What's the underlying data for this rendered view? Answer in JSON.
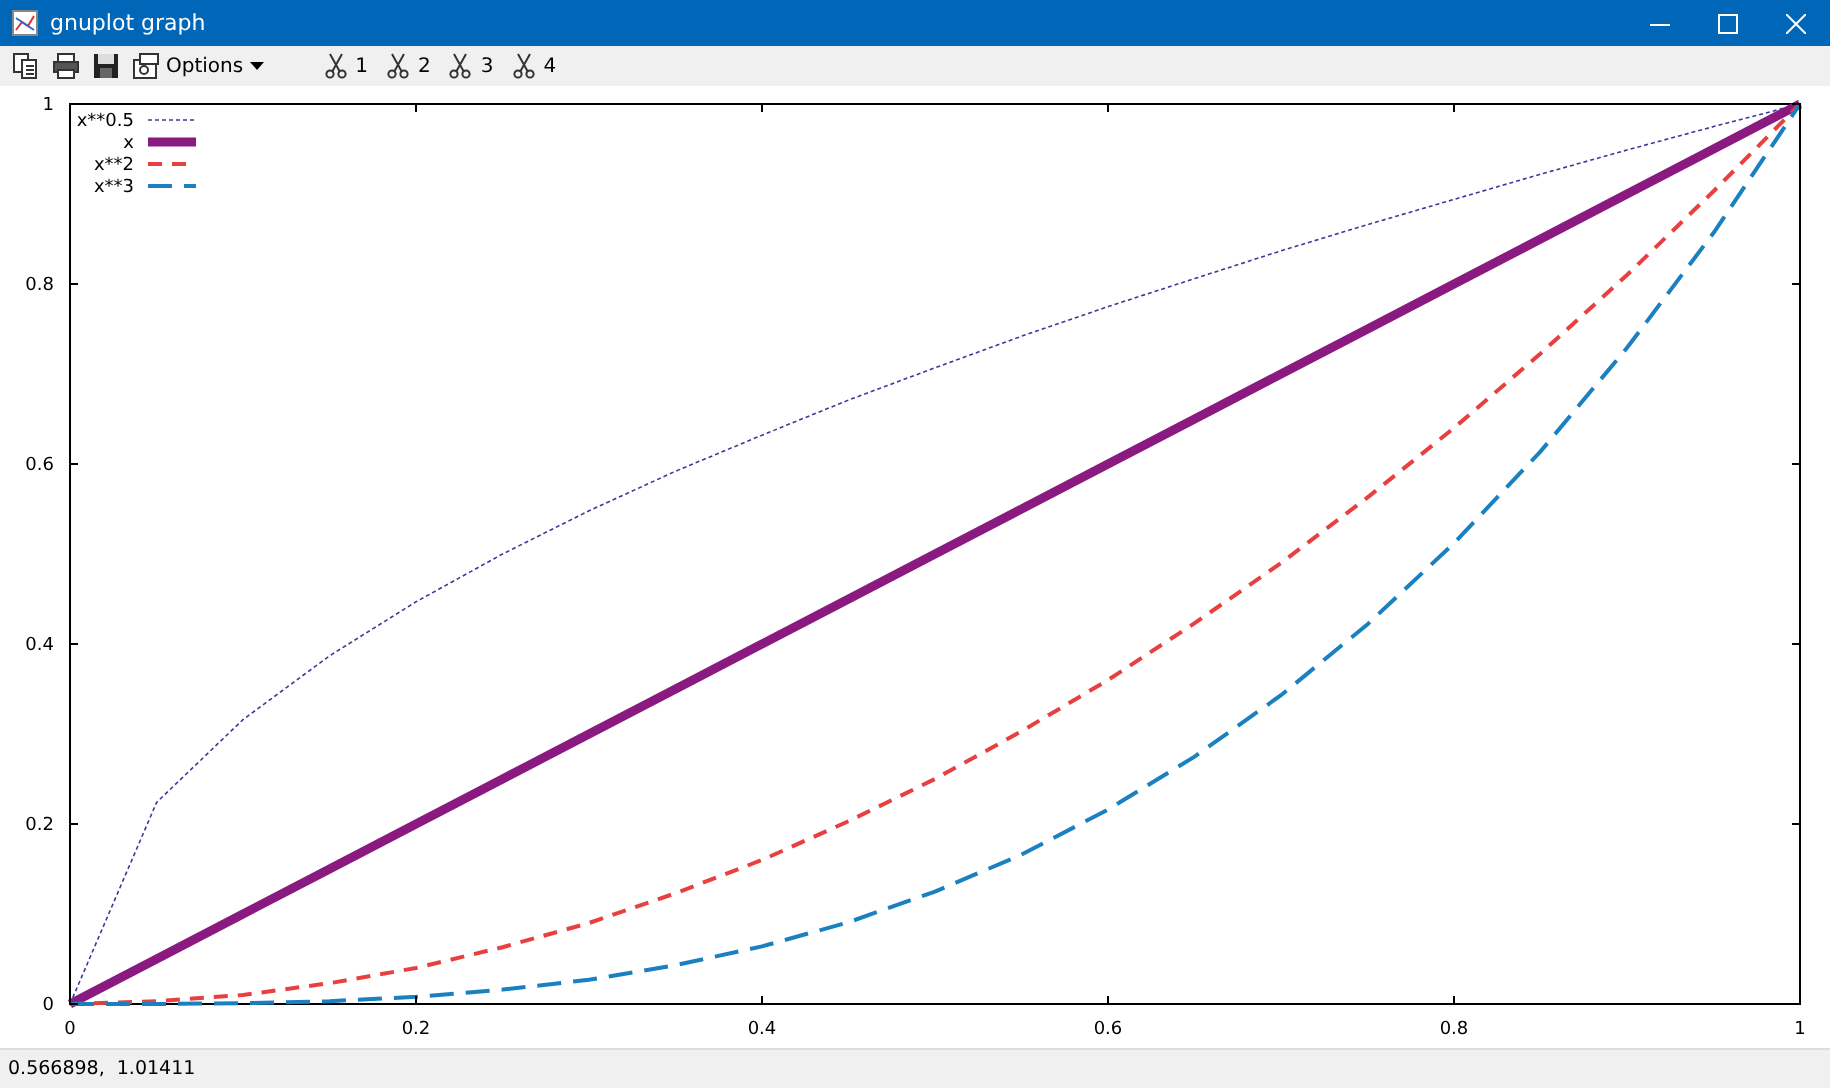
{
  "window": {
    "title": "gnuplot graph"
  },
  "toolbar": {
    "buttons": [
      {
        "kind": "copy"
      },
      {
        "kind": "print"
      },
      {
        "kind": "save"
      },
      {
        "kind": "options",
        "label": "Options"
      },
      {
        "kind": "scissors",
        "label": "1"
      },
      {
        "kind": "scissors",
        "label": "2"
      },
      {
        "kind": "scissors",
        "label": "3"
      },
      {
        "kind": "scissors",
        "label": "4"
      }
    ]
  },
  "plot": {
    "chart_data": {
      "type": "line",
      "x": [
        0,
        0.05,
        0.1,
        0.15,
        0.2,
        0.25,
        0.3,
        0.35,
        0.4,
        0.45,
        0.5,
        0.55,
        0.6,
        0.65,
        0.7,
        0.75,
        0.8,
        0.85,
        0.9,
        0.95,
        1
      ],
      "series": [
        {
          "name": "x**0.5",
          "color": "#3a3a9a",
          "line_style": "dotted",
          "values": [
            0,
            0.224,
            0.316,
            0.387,
            0.447,
            0.5,
            0.548,
            0.592,
            0.632,
            0.671,
            0.707,
            0.742,
            0.775,
            0.806,
            0.837,
            0.866,
            0.894,
            0.922,
            0.949,
            0.975,
            1
          ]
        },
        {
          "name": "x",
          "color": "#8b1a80",
          "line_style": "solid",
          "values": [
            0,
            0.05,
            0.1,
            0.15,
            0.2,
            0.25,
            0.3,
            0.35,
            0.4,
            0.45,
            0.5,
            0.55,
            0.6,
            0.65,
            0.7,
            0.75,
            0.8,
            0.85,
            0.9,
            0.95,
            1
          ]
        },
        {
          "name": "x**2",
          "color": "#e84040",
          "line_style": "dashed",
          "values": [
            0,
            0.003,
            0.01,
            0.023,
            0.04,
            0.063,
            0.09,
            0.123,
            0.16,
            0.203,
            0.25,
            0.303,
            0.36,
            0.423,
            0.49,
            0.563,
            0.64,
            0.723,
            0.81,
            0.903,
            1
          ]
        },
        {
          "name": "x**3",
          "color": "#1a80c0",
          "line_style": "long-dashed",
          "values": [
            0,
            0,
            0.001,
            0.003,
            0.008,
            0.016,
            0.027,
            0.043,
            0.064,
            0.091,
            0.125,
            0.166,
            0.216,
            0.275,
            0.343,
            0.422,
            0.512,
            0.614,
            0.729,
            0.857,
            1
          ]
        }
      ],
      "legend": true,
      "xlim": [
        0,
        1
      ],
      "ylim": [
        0,
        1
      ],
      "xticks": [
        {
          "value": 0,
          "label": "0"
        },
        {
          "value": 0.2,
          "label": "0.2"
        },
        {
          "value": 0.4,
          "label": "0.4"
        },
        {
          "value": 0.6,
          "label": "0.6"
        },
        {
          "value": 0.8,
          "label": "0.8"
        },
        {
          "value": 1,
          "label": "1"
        }
      ],
      "yticks": [
        {
          "value": 0,
          "label": "0"
        },
        {
          "value": 0.2,
          "label": "0.2"
        },
        {
          "value": 0.4,
          "label": "0.4"
        },
        {
          "value": 0.6,
          "label": "0.6"
        },
        {
          "value": 0.8,
          "label": "0.8"
        },
        {
          "value": 1,
          "label": "1"
        }
      ]
    }
  },
  "status_bar": {
    "text": "0.566898,  1.01411"
  }
}
